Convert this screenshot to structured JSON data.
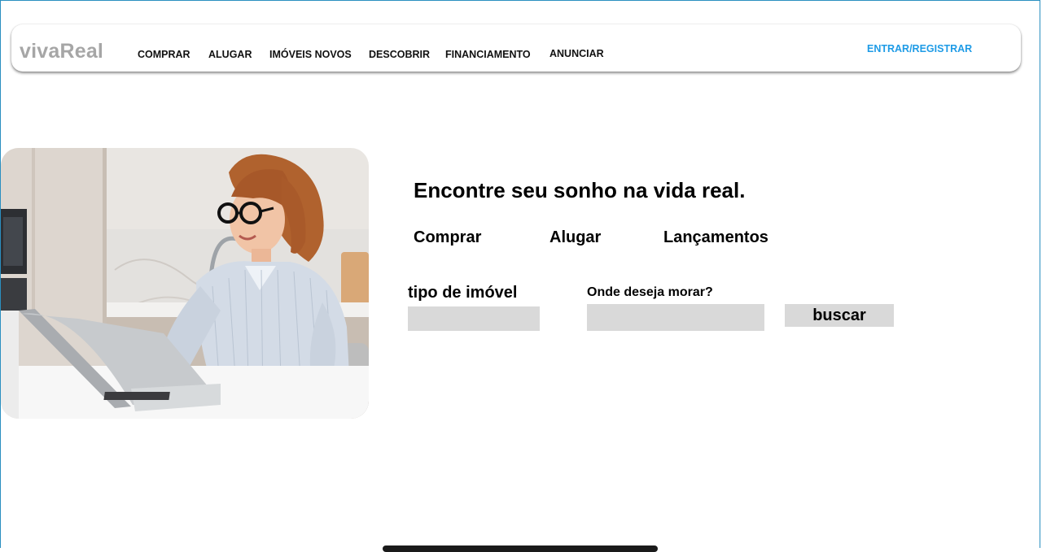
{
  "header": {
    "logo": "vivaReal",
    "nav": [
      {
        "label": "COMPRAR"
      },
      {
        "label": "ALUGAR"
      },
      {
        "label": "IMÓVEIS NOVOS"
      },
      {
        "label": "DESCOBRIR"
      },
      {
        "label": "FINANCIAMENTO"
      },
      {
        "label": "ANUNCIAR"
      }
    ],
    "login": "ENTRAR/REGISTRAR"
  },
  "hero": {
    "image_desc_icon": "woman-laptop-photo",
    "headline": "Encontre seu sonho na vida real.",
    "tabs": [
      {
        "label": "Comprar"
      },
      {
        "label": "Alugar"
      },
      {
        "label": "Lançamentos"
      }
    ],
    "search": {
      "type_label": "tipo de imóvel",
      "type_value": "",
      "location_label": "Onde deseja morar?",
      "location_value": "",
      "button": "buscar"
    }
  },
  "colors": {
    "accent": "#1e9be6",
    "logo": "#a6a6a6",
    "input_bg": "#d9d9d9"
  }
}
